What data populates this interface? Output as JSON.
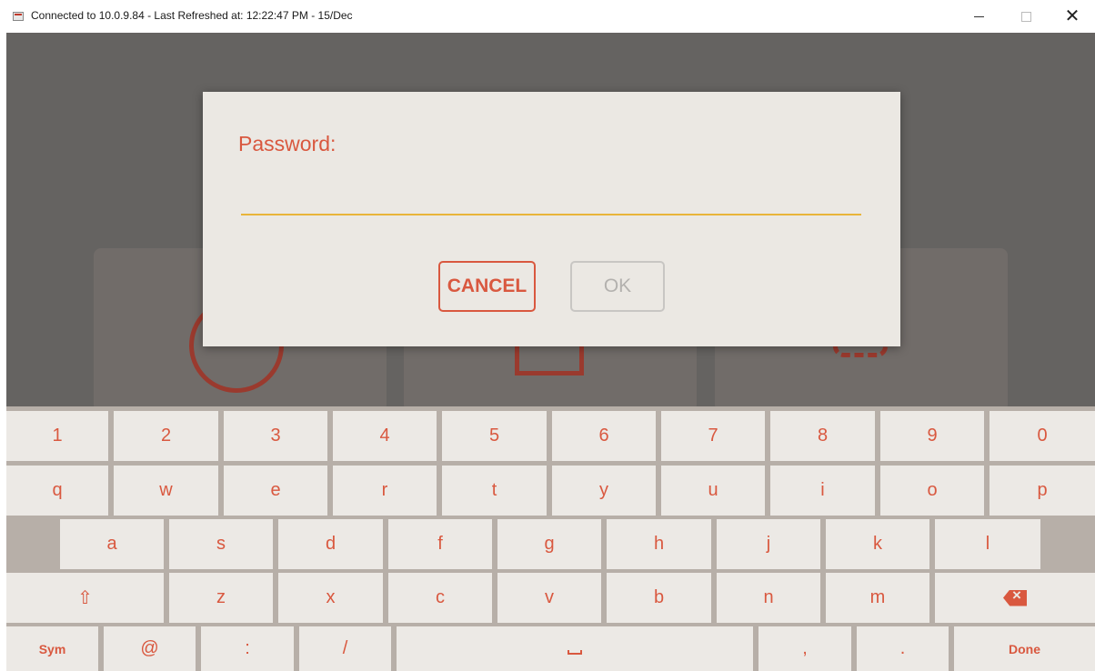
{
  "window": {
    "title": "Connected to 10.0.9.84 - Last Refreshed at: 12:22:47 PM - 15/Dec",
    "close_glyph": "✕"
  },
  "dialog": {
    "label": "Password:",
    "password_value": "",
    "cancel_label": "CANCEL",
    "ok_label": "OK"
  },
  "keyboard": {
    "row1": [
      "1",
      "2",
      "3",
      "4",
      "5",
      "6",
      "7",
      "8",
      "9",
      "0"
    ],
    "row2": [
      "q",
      "w",
      "e",
      "r",
      "t",
      "y",
      "u",
      "i",
      "o",
      "p"
    ],
    "row3": [
      "a",
      "s",
      "d",
      "f",
      "g",
      "h",
      "j",
      "k",
      "l"
    ],
    "row4": [
      "z",
      "x",
      "c",
      "v",
      "b",
      "n",
      "m"
    ],
    "shift_glyph": "⇧",
    "sym_label": "Sym",
    "at_label": "@",
    "colon_label": ":",
    "slash_label": "/",
    "comma_label": ",",
    "period_label": ".",
    "done_label": "Done"
  },
  "colors": {
    "accent": "#d9583f",
    "input_underline": "#e8b53a",
    "dialog_bg": "#ebe8e3",
    "keyboard_bg": "#b7afa8",
    "key_bg": "#ece9e5"
  },
  "icons": {
    "app_icon": "app-window-icon",
    "backspace": "backspace-icon",
    "space": "space-bar-icon",
    "shift": "shift-arrow-icon"
  }
}
